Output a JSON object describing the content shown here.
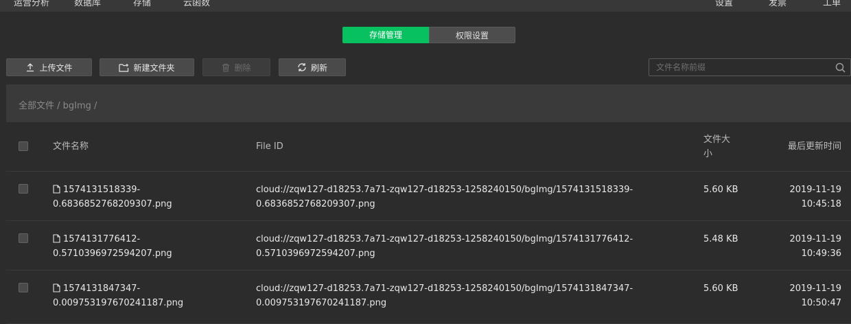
{
  "topnav": {
    "left": [
      "运营分析",
      "数据库",
      "存储",
      "云函数"
    ],
    "right": [
      "设置",
      "发票",
      "工单"
    ]
  },
  "tabs": {
    "storage": "存储管理",
    "permission": "权限设置"
  },
  "toolbar": {
    "upload": "上传文件",
    "new_folder": "新建文件夹",
    "delete": "删除",
    "refresh": "刷新",
    "search_placeholder": "文件名称前缀"
  },
  "breadcrumb": "全部文件 / bgImg /",
  "table": {
    "headers": {
      "name": "文件名称",
      "file_id": "File ID",
      "size": "文件大小",
      "updated": "最后更新时间"
    },
    "rows": [
      {
        "name": "1574131518339-0.6836852768209307.png",
        "file_id": "cloud://zqw127-d18253.7a71-zqw127-d18253-1258240150/bgImg/1574131518339-0.6836852768209307.png",
        "size": "5.60 KB",
        "date": "2019-11-19",
        "time": "10:45:18"
      },
      {
        "name": "1574131776412-0.5710396972594207.png",
        "file_id": "cloud://zqw127-d18253.7a71-zqw127-d18253-1258240150/bgImg/1574131776412-0.5710396972594207.png",
        "size": "5.48 KB",
        "date": "2019-11-19",
        "time": "10:49:36"
      },
      {
        "name": "1574131847347-0.009753197670241187.png",
        "file_id": "cloud://zqw127-d18253.7a71-zqw127-d18253-1258240150/bgImg/1574131847347-0.009753197670241187.png",
        "size": "5.60 KB",
        "date": "2019-11-19",
        "time": "10:50:47"
      }
    ]
  },
  "colors": {
    "accent": "#07c160",
    "background": "#2c2c2c",
    "panel": "#3a3a3a"
  }
}
